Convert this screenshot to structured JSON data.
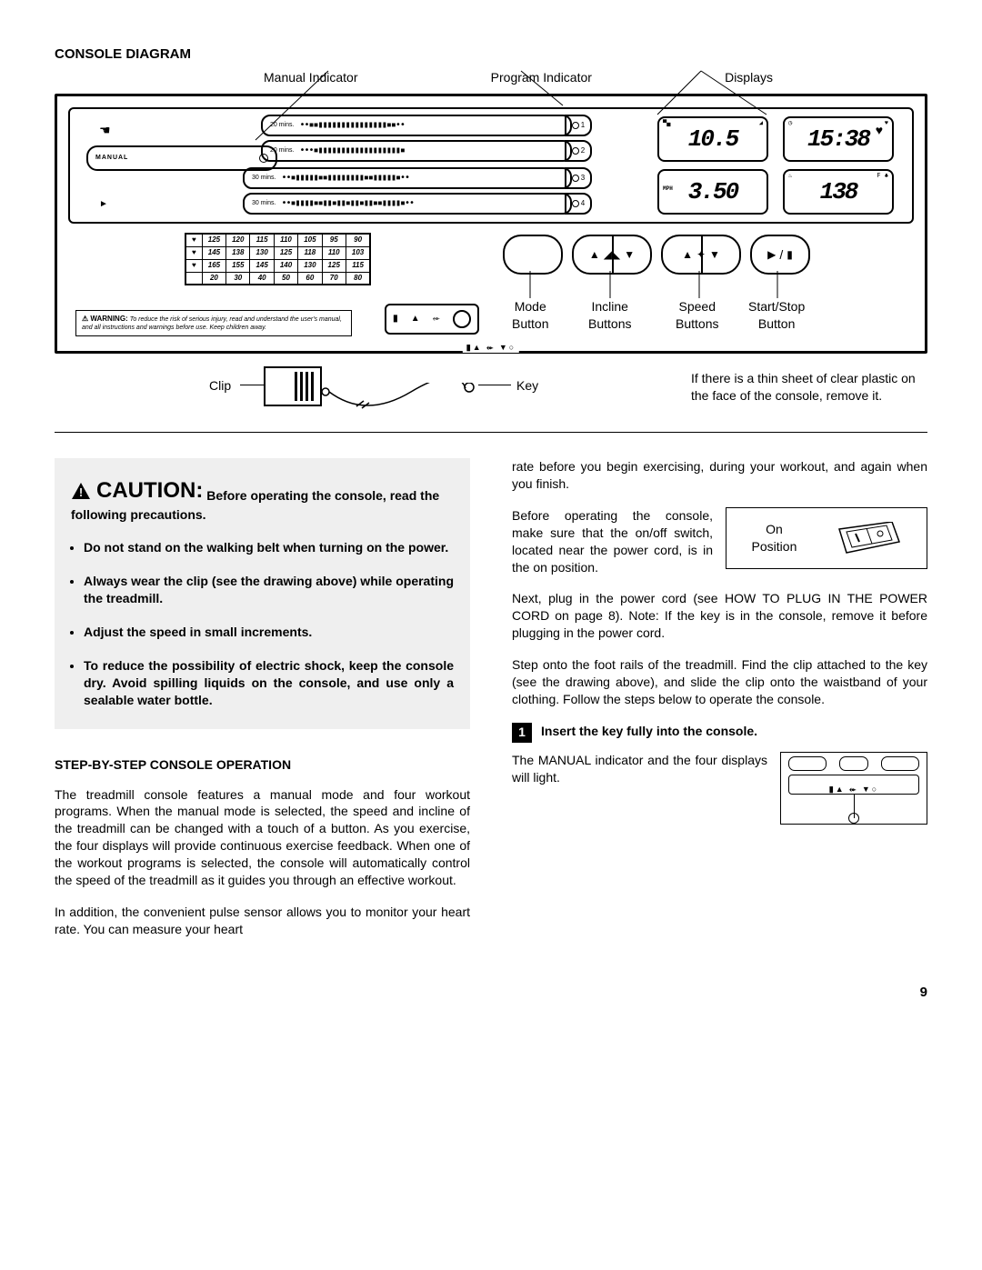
{
  "page_number": "9",
  "console_diagram": {
    "title": "CONSOLE DIAGRAM",
    "top_labels": {
      "manual_indicator": "Manual Indicator",
      "program_indicator": "Program Indicator",
      "displays": "Displays"
    },
    "manual_label": "MANUAL",
    "program_rows": [
      {
        "prefix": "20 mins.",
        "led": "1"
      },
      {
        "prefix": "20 mins.",
        "led": "2"
      },
      {
        "prefix": "30 mins.",
        "led": "3"
      },
      {
        "prefix": "30 mins.",
        "led": "4"
      }
    ],
    "displays_values": {
      "top_left": "10.5",
      "top_right": "15:38",
      "bottom_left": "3.50",
      "bottom_left_unit": "MPH",
      "bottom_right": "138",
      "bottom_right_unit": "F ♣"
    },
    "hr_table": [
      [
        "♥",
        "125",
        "120",
        "115",
        "110",
        "105",
        "95",
        "90"
      ],
      [
        "♥",
        "145",
        "138",
        "130",
        "125",
        "118",
        "110",
        "103"
      ],
      [
        "♥",
        "165",
        "155",
        "145",
        "140",
        "130",
        "125",
        "115"
      ],
      [
        "",
        "20",
        "30",
        "40",
        "50",
        "60",
        "70",
        "80"
      ]
    ],
    "warning_panel": {
      "lead": "⚠ WARNING:",
      "text": "To reduce the risk of serious injury, read and understand the user's manual, and all instructions and warnings before use. Keep children away."
    },
    "button_labels": {
      "mode": "Mode\nButton",
      "incline": "Incline\nButtons",
      "speed": "Speed\nButtons",
      "startstop": "Start/Stop\nButton"
    },
    "clip_label": "Clip",
    "key_label": "Key",
    "side_note": "If there is a thin sheet of clear plastic on the face of the console, remove it."
  },
  "caution": {
    "lead": "CAUTION:",
    "tail": "Before operating the console, read the following precautions.",
    "bullets": [
      "Do not stand on the walking belt when turning on the power.",
      "Always wear the clip (see the drawing above) while operating the treadmill.",
      "Adjust the speed in small increments.",
      "To reduce the possibility of electric shock, keep the console dry. Avoid spilling liquids on the console, and use only a sealable  water bottle."
    ]
  },
  "operation": {
    "heading": "STEP-BY-STEP CONSOLE OPERATION",
    "para1": "The treadmill console features a manual mode and four workout programs. When the manual mode is selected, the speed and incline of the treadmill can be changed with a touch of a button. As you exercise, the four displays will provide continuous exercise feedback. When one of the workout programs is selected, the console will automatically control the speed of the treadmill as it guides you through an effective workout.",
    "para2": "In addition, the convenient pulse sensor allows you to monitor your heart rate. You can measure your heart"
  },
  "right_col": {
    "cont": "rate before you begin exercising, during your workout, and again when you finish.",
    "on_para": "Before operating the console, make sure that the on/off switch, located near the power cord, is in the on position.",
    "on_label": "On\nPosition",
    "plug_para": "Next, plug in the power cord (see HOW TO PLUG IN THE POWER CORD on page 8). Note: If the key is in the console, remove it before plugging in the power cord.",
    "step_para": "Step onto the foot rails of the treadmill. Find the clip attached to the key (see the drawing above), and slide the clip onto the waistband of your clothing. Follow the steps below to operate the console.",
    "step1": {
      "num": "1",
      "title": "Insert the key fully into the console.",
      "body": "The MANUAL indicator and the four displays will light."
    }
  }
}
